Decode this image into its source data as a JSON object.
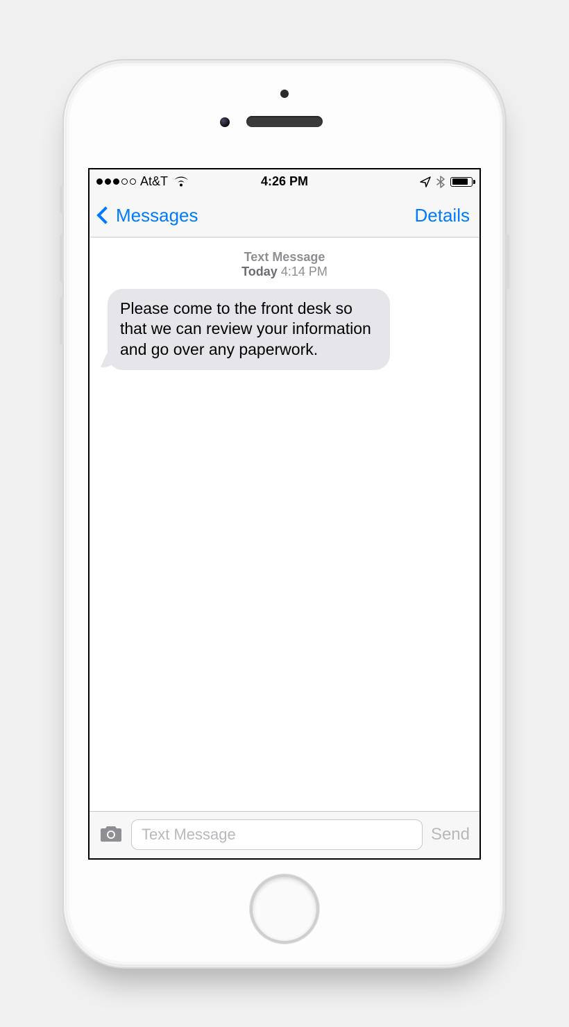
{
  "status": {
    "carrier": "At&T",
    "time": "4:26 PM"
  },
  "nav": {
    "back_label": "Messages",
    "details_label": "Details"
  },
  "thread": {
    "type_label": "Text Message",
    "day_label": "Today",
    "time_label": "4:14 PM",
    "incoming_text": "Please come to the front desk so that we can review your information and go over any paperwork."
  },
  "compose": {
    "placeholder": "Text Message",
    "send_label": "Send"
  }
}
